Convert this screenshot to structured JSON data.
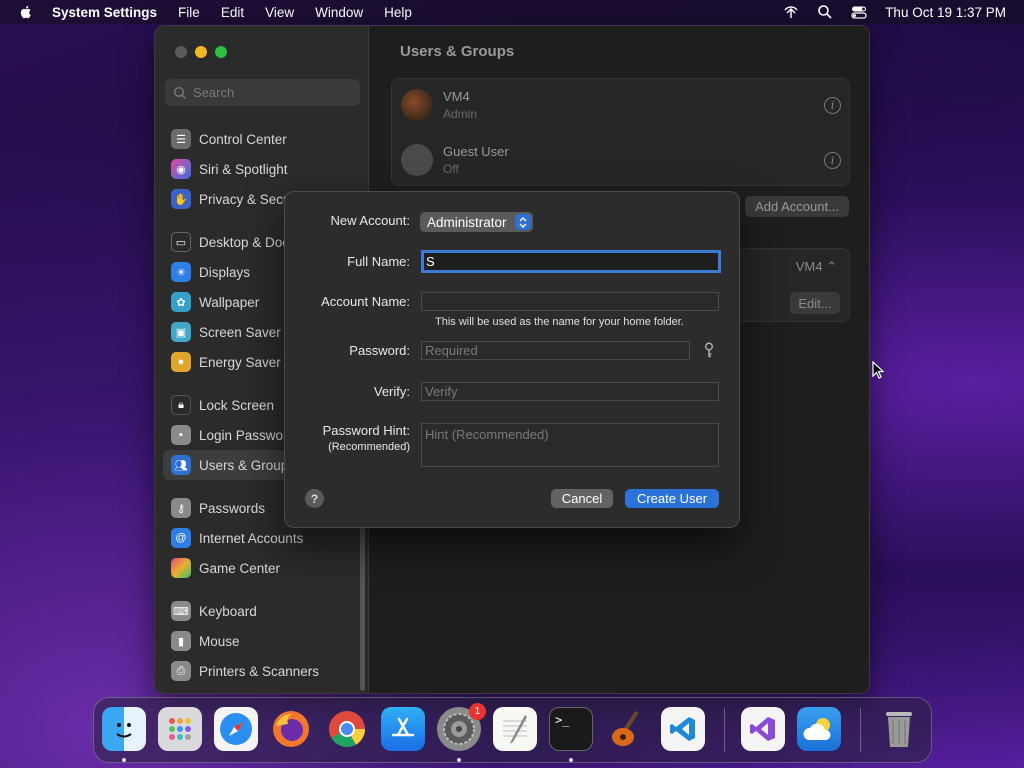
{
  "menubar": {
    "app_name": "System Settings",
    "items": [
      "File",
      "Edit",
      "View",
      "Window",
      "Help"
    ],
    "clock": "Thu Oct 19  1:37 PM"
  },
  "sidebar": {
    "search_placeholder": "Search",
    "items": [
      {
        "label": "Control Center",
        "icon": "control-center-icon",
        "color": "#6b6b6b"
      },
      {
        "label": "Siri & Spotlight",
        "icon": "siri-icon",
        "color": "#b03a8e"
      },
      {
        "label": "Privacy & Security",
        "icon": "hand-icon",
        "color": "#3a62c7"
      },
      {
        "label": "Desktop & Dock",
        "icon": "dock-icon",
        "color": "#2a2a2a"
      },
      {
        "label": "Displays",
        "icon": "sun-icon",
        "color": "#2f7ee6"
      },
      {
        "label": "Wallpaper",
        "icon": "flower-icon",
        "color": "#36a0c9"
      },
      {
        "label": "Screen Saver",
        "icon": "screen-saver-icon",
        "color": "#44a7c8"
      },
      {
        "label": "Energy Saver",
        "icon": "bulb-icon",
        "color": "#e2a52b"
      },
      {
        "label": "Lock Screen",
        "icon": "lock-icon",
        "color": "#2a2a2a"
      },
      {
        "label": "Login Password",
        "icon": "login-lock-icon",
        "color": "#8a8a8a"
      },
      {
        "label": "Users & Groups",
        "icon": "users-icon",
        "color": "#2f6fd1"
      },
      {
        "label": "Passwords",
        "icon": "key-icon",
        "color": "#8a8a8a"
      },
      {
        "label": "Internet Accounts",
        "icon": "at-icon",
        "color": "#2f7ee6"
      },
      {
        "label": "Game Center",
        "icon": "game-center-icon",
        "color": "#d04a7a"
      },
      {
        "label": "Keyboard",
        "icon": "keyboard-icon",
        "color": "#8a8a8a"
      },
      {
        "label": "Mouse",
        "icon": "mouse-icon",
        "color": "#8a8a8a"
      },
      {
        "label": "Printers & Scanners",
        "icon": "printer-icon",
        "color": "#8a8a8a"
      }
    ]
  },
  "main": {
    "title": "Users & Groups",
    "users": [
      {
        "name": "VM4",
        "role": "Admin"
      },
      {
        "name": "Guest User",
        "role": "Off"
      }
    ],
    "add_account_label": "Add Account...",
    "auto_login_value": "VM4",
    "edit_label": "Edit..."
  },
  "dialog": {
    "new_account_label": "New Account:",
    "account_type": "Administrator",
    "full_name_label": "Full Name:",
    "full_name_value": "S",
    "account_name_label": "Account Name:",
    "account_name_value": "",
    "account_name_hint": "This will be used as the name for your home folder.",
    "password_label": "Password:",
    "password_placeholder": "Required",
    "verify_label": "Verify:",
    "verify_placeholder": "Verify",
    "hint_label": "Password Hint:",
    "hint_label_sub": "(Recommended)",
    "hint_placeholder": "Hint (Recommended)",
    "cancel_label": "Cancel",
    "create_label": "Create User"
  },
  "dock": {
    "system_settings_badge": "1"
  }
}
